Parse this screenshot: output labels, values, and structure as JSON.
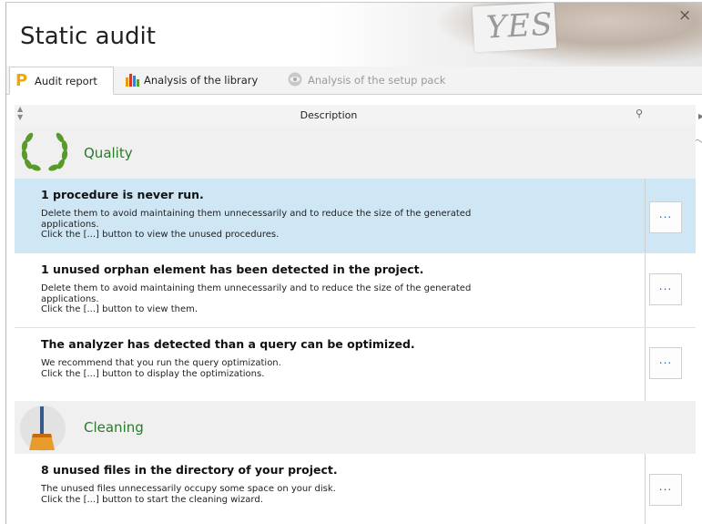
{
  "window": {
    "title": "Static audit",
    "banner_text": "YES",
    "close_label": "×"
  },
  "tabs": [
    {
      "label": "Audit report",
      "icon": "p-letter-icon",
      "state": "active"
    },
    {
      "label": "Analysis of the library",
      "icon": "bar-chart-icon",
      "state": "normal"
    },
    {
      "label": "Analysis of the setup pack",
      "icon": "eye-icon",
      "state": "disabled"
    }
  ],
  "grid": {
    "column_header": "Description",
    "sort_icon": "sort-arrows-icon",
    "search_icon": "search-icon"
  },
  "sections": [
    {
      "label": "Quality",
      "icon": "laurel-wreath-icon",
      "items": [
        {
          "title": "1 procedure is never run.",
          "desc": "Delete them to avoid maintaining them unnecessarily and to reduce the size of the generated\napplications.\nClick the [...] button to view the unused procedures.",
          "button": "...",
          "selected": true
        },
        {
          "title": "1 unused orphan element has been detected in the project.",
          "desc": "Delete them to avoid maintaining them unnecessarily and to reduce the size of the generated\napplications.\nClick the [...] button to view them.",
          "button": "...",
          "selected": false
        },
        {
          "title": "The analyzer has detected than a query can be optimized.",
          "desc": "We recommend that you run the query optimization.\nClick the [...] button to display the optimizations.",
          "button": "...",
          "selected": false
        }
      ]
    },
    {
      "label": "Cleaning",
      "icon": "broom-icon",
      "items": [
        {
          "title": "8 unused files in the directory of your project.",
          "desc": "The unused files unnecessarily occupy some space on your disk.\nClick the [...] button to start the cleaning wizard.",
          "button": "...",
          "selected": false
        }
      ]
    }
  ],
  "colors": {
    "selected_row": "#cfe6f5",
    "section_label": "#2a7a2a",
    "button_text": "#2a6fb0"
  }
}
